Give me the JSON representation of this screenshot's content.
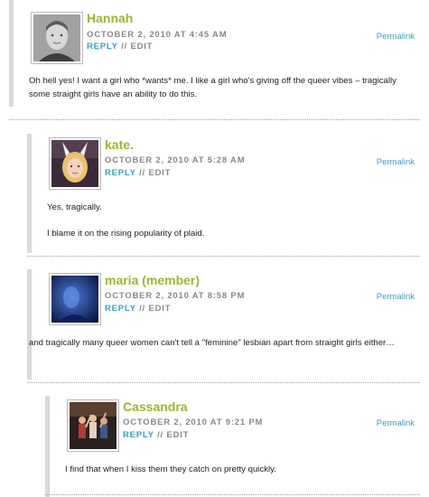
{
  "comments": [
    {
      "author": "Hannah",
      "date": "OCTOBER 2, 2010 AT 4:45 AM",
      "reply_label": "REPLY",
      "separator": "//",
      "edit_label": "EDIT",
      "permalink_label": "Permalink",
      "name_color": "#9bb82c",
      "body": [
        "Oh hell yes! I want a girl who *wants* me. I like a girl who's giving off the queer vibes – tragically some straight girls have an ability to do this."
      ]
    },
    {
      "author": "kate.",
      "date": "OCTOBER 2, 2010 AT 5:28 AM",
      "reply_label": "REPLY",
      "separator": "//",
      "edit_label": "EDIT",
      "permalink_label": "Permalink",
      "name_color": "#9bb82c",
      "body": [
        "Yes, tragically.",
        "I blame it on the rising popularity of plaid."
      ]
    },
    {
      "author": "maria (member)",
      "date": "OCTOBER 2, 2010 AT 8:58 PM",
      "reply_label": "REPLY",
      "separator": "//",
      "edit_label": "EDIT",
      "permalink_label": "Permalink",
      "name_color": "#9bb82c",
      "body": [
        "and tragically many queer women can't tell a \"feminine\" lesbian apart from straight girls either…"
      ]
    },
    {
      "author": "Cassandra",
      "date": "OCTOBER 2, 2010 AT 9:21 PM",
      "reply_label": "REPLY",
      "separator": "//",
      "edit_label": "EDIT",
      "permalink_label": "Permalink",
      "name_color": "#9bb82c",
      "body": [
        "I find that when I kiss them they catch on pretty quickly."
      ]
    }
  ],
  "colors": {
    "link": "#33a3c4",
    "meta": "#888888",
    "bar": "#d9d9d9"
  },
  "icons": [
    "avatar-hannah",
    "avatar-kate",
    "avatar-maria",
    "avatar-cassandra"
  ]
}
